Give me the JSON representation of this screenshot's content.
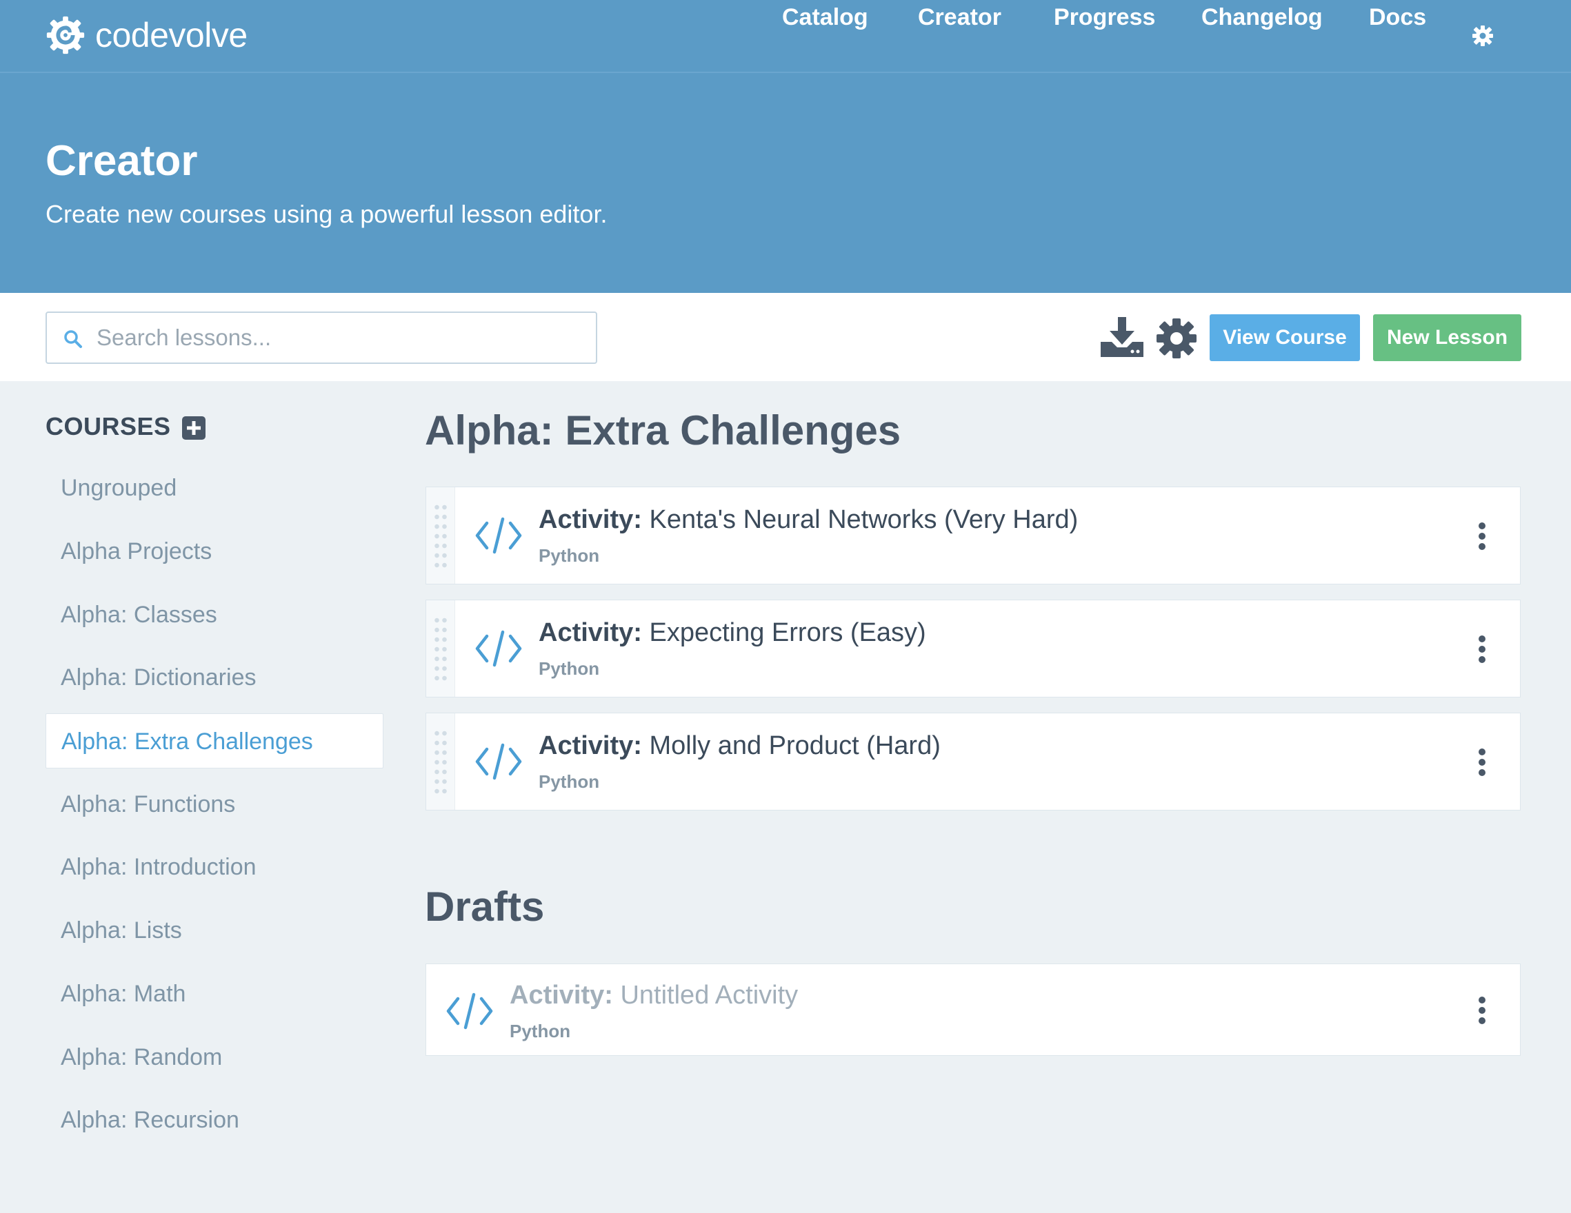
{
  "brand": {
    "name": "codevolve"
  },
  "nav": {
    "links": [
      "Catalog",
      "Creator",
      "Progress",
      "Changelog",
      "Docs"
    ]
  },
  "hero": {
    "title": "Creator",
    "subtitle": "Create new courses using a powerful lesson editor."
  },
  "toolbar": {
    "search_placeholder": "Search lessons...",
    "view_course": "View Course",
    "new_lesson": "New Lesson"
  },
  "sidebar": {
    "heading": "COURSES",
    "items": [
      "Ungrouped",
      "Alpha Projects",
      "Alpha: Classes",
      "Alpha: Dictionaries",
      "Alpha: Extra Challenges",
      "Alpha: Functions",
      "Alpha: Introduction",
      "Alpha: Lists",
      "Alpha: Math",
      "Alpha: Random",
      "Alpha: Recursion"
    ],
    "active_item": "Alpha: Extra Challenges"
  },
  "main": {
    "course_title": "Alpha: Extra Challenges",
    "lessons": [
      {
        "prefix": "Activity:",
        "name": "Kenta's Neural Networks (Very Hard)",
        "language": "Python"
      },
      {
        "prefix": "Activity:",
        "name": "Expecting Errors (Easy)",
        "language": "Python"
      },
      {
        "prefix": "Activity:",
        "name": "Molly and Product (Hard)",
        "language": "Python"
      }
    ],
    "drafts_title": "Drafts",
    "drafts": [
      {
        "prefix": "Activity:",
        "name": "Untitled Activity",
        "language": "Python"
      }
    ]
  },
  "colors": {
    "header_blue": "#5b9bc6",
    "view_course_blue": "#5aaee6",
    "new_lesson_green": "#67c083",
    "active_link_blue": "#4a9ed4",
    "page_background": "#ecf1f4"
  },
  "icons": {
    "logo": "gear-swirl-logo-icon",
    "nav_settings": "gear-icon",
    "search": "search-icon",
    "download": "download-icon",
    "course_settings": "gear-icon",
    "add_course": "plus-square-icon",
    "lesson": "code-brackets-icon",
    "lesson_menu": "vertical-ellipsis-icon",
    "drag": "drag-handle-icon"
  }
}
